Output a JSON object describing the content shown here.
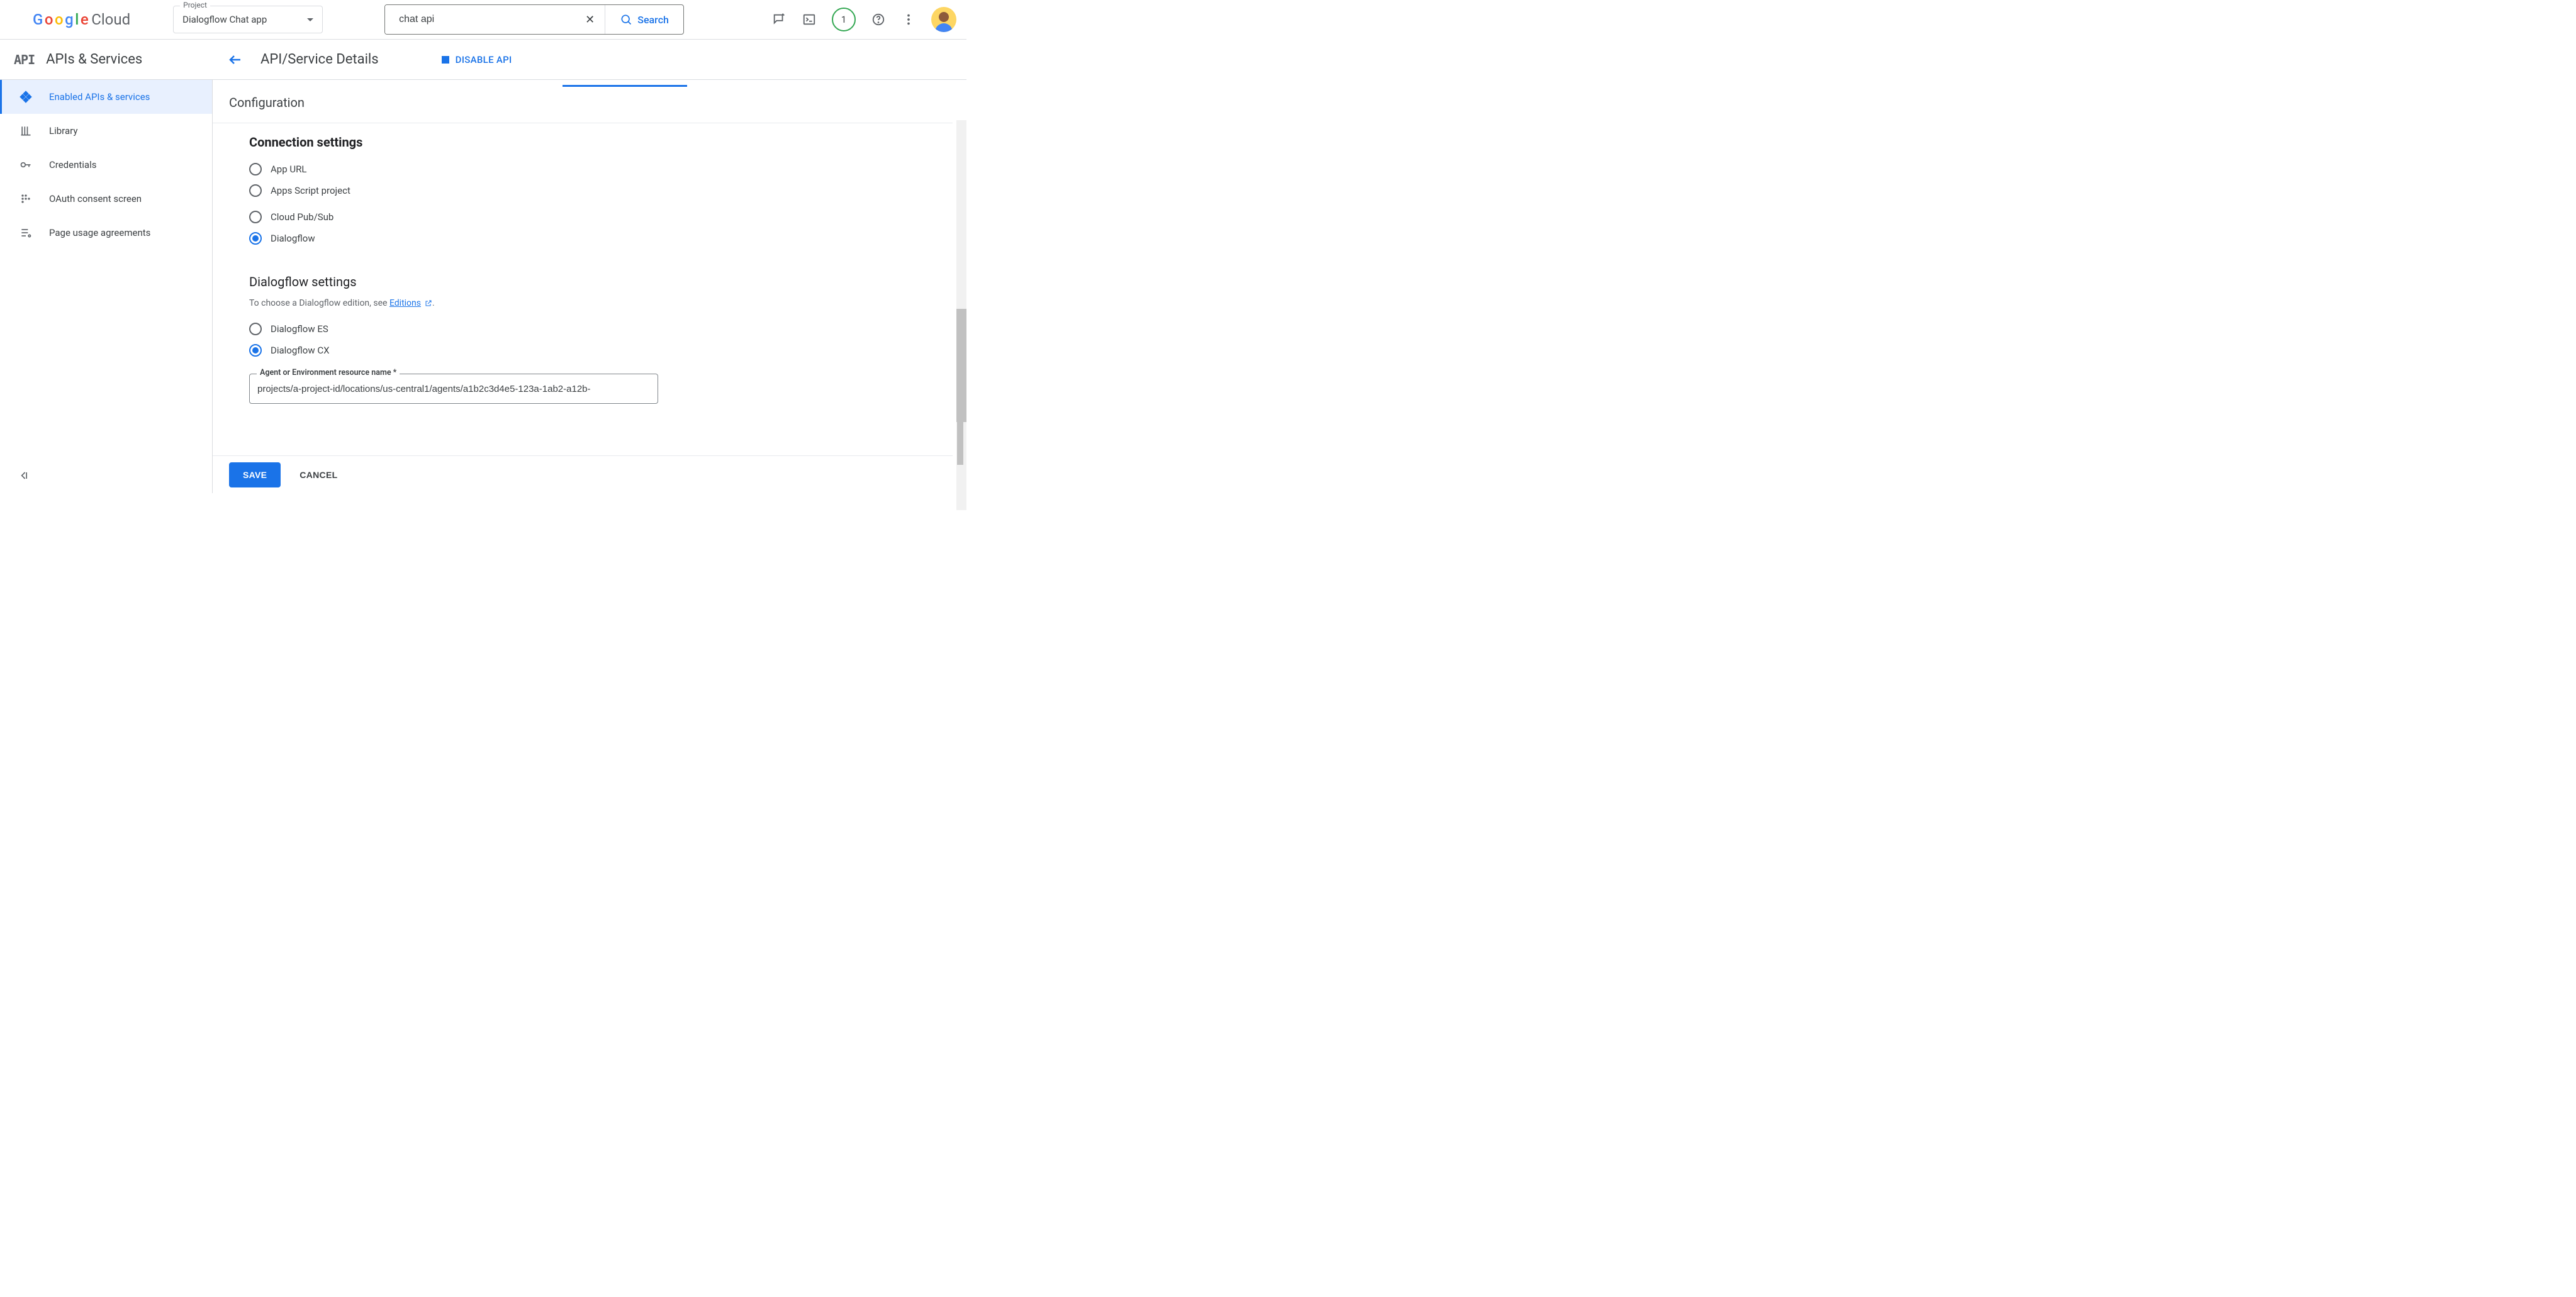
{
  "header": {
    "project_label": "Project",
    "project_value": "Dialogflow Chat app",
    "search_value": "chat api",
    "search_button": "Search",
    "badge_count": "1"
  },
  "section_bar": {
    "product_badge": "API",
    "product_title": "APIs & Services",
    "page_title": "API/Service Details",
    "disable_label": "DISABLE API"
  },
  "sidebar": {
    "items": [
      {
        "label": "Enabled APIs & services",
        "active": true
      },
      {
        "label": "Library"
      },
      {
        "label": "Credentials"
      },
      {
        "label": "OAuth consent screen"
      },
      {
        "label": "Page usage agreements"
      }
    ]
  },
  "main": {
    "config_heading": "Configuration",
    "connection": {
      "heading": "Connection settings",
      "options": [
        {
          "label": "App URL",
          "checked": false
        },
        {
          "label": "Apps Script project",
          "checked": false
        },
        {
          "label": "Cloud Pub/Sub",
          "checked": false
        },
        {
          "label": "Dialogflow",
          "checked": true
        }
      ]
    },
    "dialogflow": {
      "heading": "Dialogflow settings",
      "hint_prefix": "To choose a Dialogflow edition, see ",
      "hint_link": "Editions",
      "hint_suffix": ".",
      "options": [
        {
          "label": "Dialogflow ES",
          "checked": false
        },
        {
          "label": "Dialogflow CX",
          "checked": true
        }
      ],
      "field_label": "Agent or Environment resource name *",
      "field_value": "projects/a-project-id/locations/us-central1/agents/a1b2c3d4e5-123a-1ab2-a12b-"
    },
    "save_label": "SAVE",
    "cancel_label": "CANCEL"
  }
}
